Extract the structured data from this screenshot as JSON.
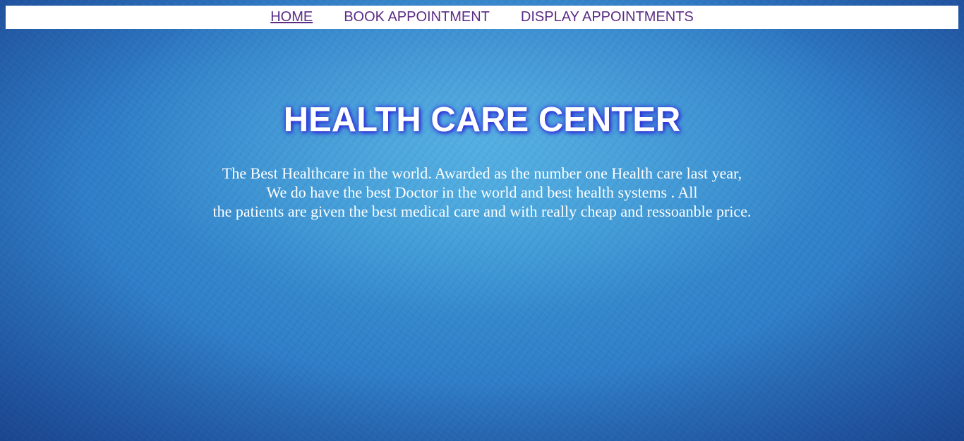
{
  "nav": {
    "items": [
      {
        "label": "HOME",
        "active": true
      },
      {
        "label": "BOOK APPOINTMENT",
        "active": false
      },
      {
        "label": "DISPLAY APPOINTMENTS",
        "active": false
      }
    ]
  },
  "hero": {
    "title": "HEALTH CARE CENTER",
    "description_lines": [
      "The Best Healthcare in the world. Awarded as the number one Health care last year,",
      "We do have the best Doctor in the world and best health systems . All",
      "the patients are given the best medical care and with really cheap and ressoanble price."
    ]
  },
  "colors": {
    "nav_link": "#5b2c83",
    "nav_bg": "#ffffff",
    "title_glow": "#2a2ad6",
    "background": "#2f7fc8"
  }
}
